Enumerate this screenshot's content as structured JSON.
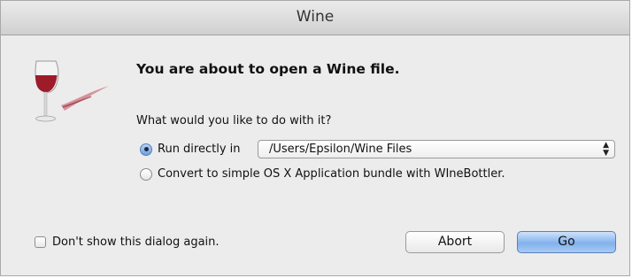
{
  "window": {
    "title": "Wine"
  },
  "icon": {
    "name": "wine-glass-icon"
  },
  "dialog": {
    "heading": "You are about to open a Wine file.",
    "question": "What would you like to do with it?"
  },
  "options": {
    "run_label": "Run directly in",
    "run_selected": true,
    "run_path": "/Users/Epsilon/Wine Files",
    "convert_label": "Convert to simple OS X Application bundle with WIneBottler.",
    "convert_selected": false
  },
  "footer": {
    "dont_show_label": "Don't show this dialog again.",
    "dont_show_checked": false,
    "abort_label": "Abort",
    "go_label": "Go"
  },
  "colors": {
    "default_button": "#82b1ec",
    "wine_red": "#9e1b2a"
  }
}
